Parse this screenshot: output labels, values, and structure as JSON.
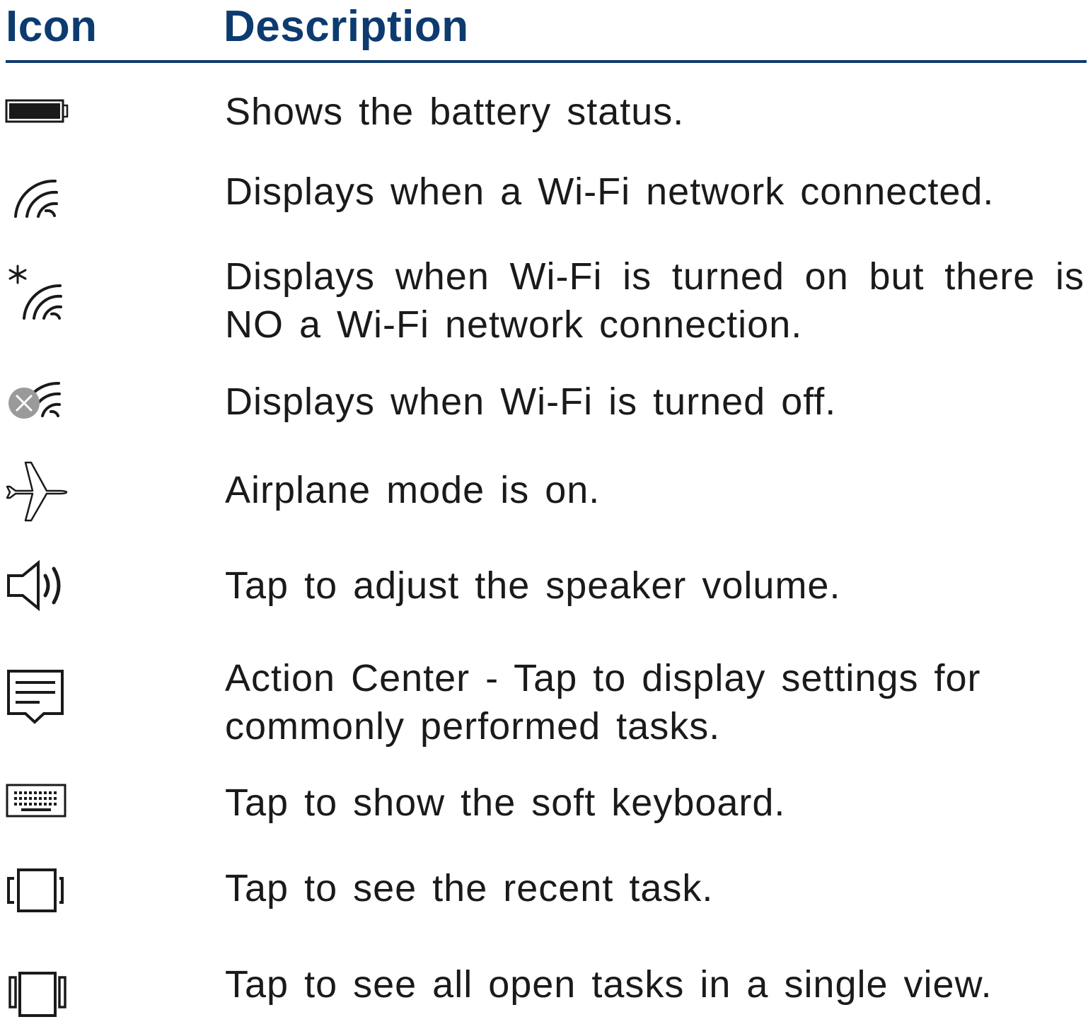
{
  "header": {
    "icon_label": "Icon",
    "description_label": "Description"
  },
  "accent_color": "#0d3b70",
  "rows": [
    {
      "icon": "battery-icon",
      "description": "Shows the battery status."
    },
    {
      "icon": "wifi-connected-icon",
      "description": "Displays when a Wi-Fi network connected."
    },
    {
      "icon": "wifi-no-connection-icon",
      "description": "Displays when Wi-Fi is turned on but there is NO a Wi-Fi network connection."
    },
    {
      "icon": "wifi-off-icon",
      "description": "Displays when Wi-Fi is turned off."
    },
    {
      "icon": "airplane-icon",
      "description": "Airplane mode is on."
    },
    {
      "icon": "speaker-icon",
      "description": "Tap to adjust the speaker volume."
    },
    {
      "icon": "action-center-icon",
      "description": "Action Center - Tap to display settings for commonly performed tasks."
    },
    {
      "icon": "keyboard-icon",
      "description": "Tap to show the soft keyboard."
    },
    {
      "icon": "recent-task-icon",
      "description": "Tap to see the recent task."
    },
    {
      "icon": "task-view-icon",
      "description": "Tap to see all open tasks in a single view."
    }
  ]
}
